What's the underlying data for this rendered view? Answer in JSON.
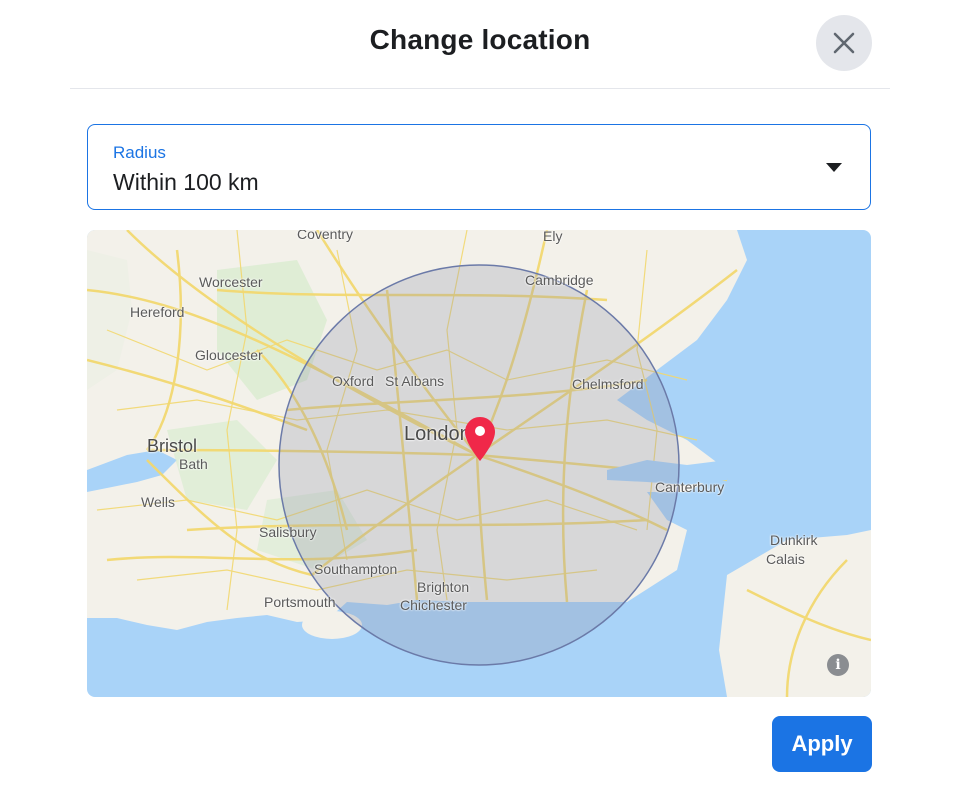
{
  "dialog": {
    "title": "Change location",
    "close_icon": "close-icon"
  },
  "radius": {
    "label": "Radius",
    "value": "Within 100 km"
  },
  "map": {
    "cities": {
      "coventry": "Coventry",
      "ely": "Ely",
      "cambridge": "Cambridge",
      "worcester": "Worcester",
      "hereford": "Hereford",
      "gloucester": "Gloucester",
      "oxford": "Oxford",
      "st_albans": "St Albans",
      "chelmsford": "Chelmsford",
      "london": "London",
      "bristol": "Bristol",
      "bath": "Bath",
      "wells": "Wells",
      "canterbury": "Canterbury",
      "salisbury": "Salisbury",
      "dunkirk": "Dunkirk",
      "calais": "Calais",
      "southampton": "Southampton",
      "brighton": "Brighton",
      "portsmouth": "Portsmouth",
      "chichester": "Chichester"
    },
    "info_icon": "i"
  },
  "actions": {
    "apply_label": "Apply"
  },
  "colors": {
    "accent": "#1b74e4",
    "pin": "#f02849",
    "water": "#a9d3f8",
    "land": "#f3f1ea",
    "roads": "#f2d870"
  }
}
